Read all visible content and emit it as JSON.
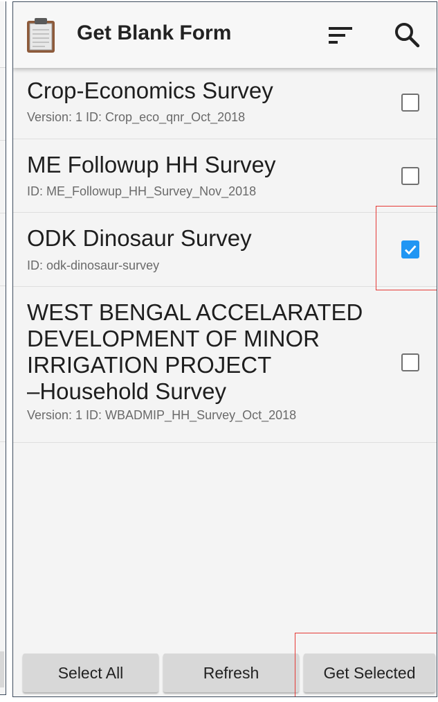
{
  "appbar": {
    "title": "Get Blank Form",
    "icons": {
      "app": "clipboard-icon",
      "sort": "sort-icon",
      "search": "search-icon"
    }
  },
  "forms": [
    {
      "title": "Crop-Economics Survey",
      "subtitle": "Version: 1 ID: Crop_eco_qnr_Oct_2018",
      "checked": false
    },
    {
      "title": "ME Followup HH Survey",
      "subtitle": "ID: ME_Followup_HH_Survey_Nov_2018",
      "checked": false
    },
    {
      "title": "ODK Dinosaur Survey",
      "subtitle": "ID: odk-dinosaur-survey",
      "checked": true
    },
    {
      "title_lines": [
        "WEST BENGAL ACCELARATED",
        "DEVELOPMENT OF MINOR",
        "IRRIGATION PROJECT",
        "–Household Survey"
      ],
      "subtitle": "Version: 1 ID: WBADMIP_HH_Survey_Oct_2018",
      "checked": false
    }
  ],
  "buttons": {
    "select_all": "Select All",
    "refresh": "Refresh",
    "get_selected": "Get Selected"
  },
  "colors": {
    "accent": "#2196f3",
    "highlight": "#e53935"
  }
}
